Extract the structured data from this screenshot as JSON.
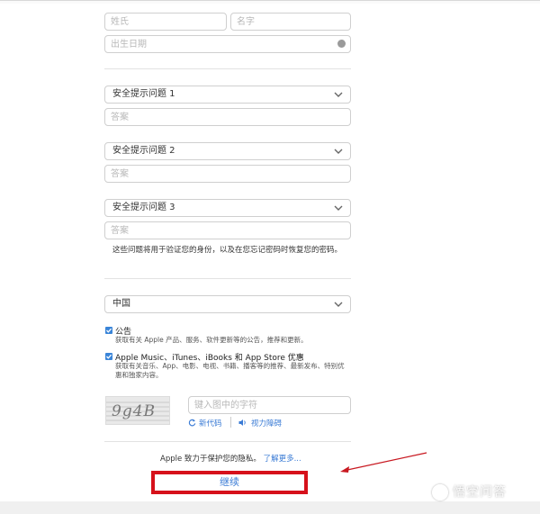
{
  "form": {
    "last_name_placeholder": "姓氏",
    "first_name_placeholder": "名字",
    "birthdate_placeholder": "出生日期",
    "security_questions": [
      {
        "label": "安全提示问题 1",
        "answer_placeholder": "答案"
      },
      {
        "label": "安全提示问题 2",
        "answer_placeholder": "答案"
      },
      {
        "label": "安全提示问题 3",
        "answer_placeholder": "答案"
      }
    ],
    "security_note": "这些问题将用于验证您的身份，以及在您忘记密码时恢复您的密码。",
    "country": "中国",
    "subscriptions": [
      {
        "title": "公告",
        "description": "获取有关 Apple 产品、服务、软件更新等的公告，推荐和更新。",
        "checked": true
      },
      {
        "title": "Apple Music、iTunes、iBooks 和 App Store 优惠",
        "description": "获取有关音乐、App、电影、电视、书籍、播客等的推荐、最新发布、特别优惠和独家内容。",
        "checked": true
      }
    ],
    "captcha": {
      "image_text": "9g4B",
      "input_placeholder": "键入图中的字符",
      "new_code_label": "新代码",
      "audio_label": "视力障碍"
    },
    "privacy_text": "Apple 致力于保护您的隐私。",
    "privacy_link": "了解更多...",
    "continue_label": "继续"
  },
  "watermark": "悟空问答",
  "colors": {
    "accent": "#3a7bd5",
    "checkbox": "#3a85d8",
    "highlight_border": "#d6111b",
    "arrow": "#c81820"
  },
  "icons": [
    "chevron-down-icon",
    "info-icon",
    "refresh-icon",
    "speaker-icon",
    "check-icon"
  ]
}
